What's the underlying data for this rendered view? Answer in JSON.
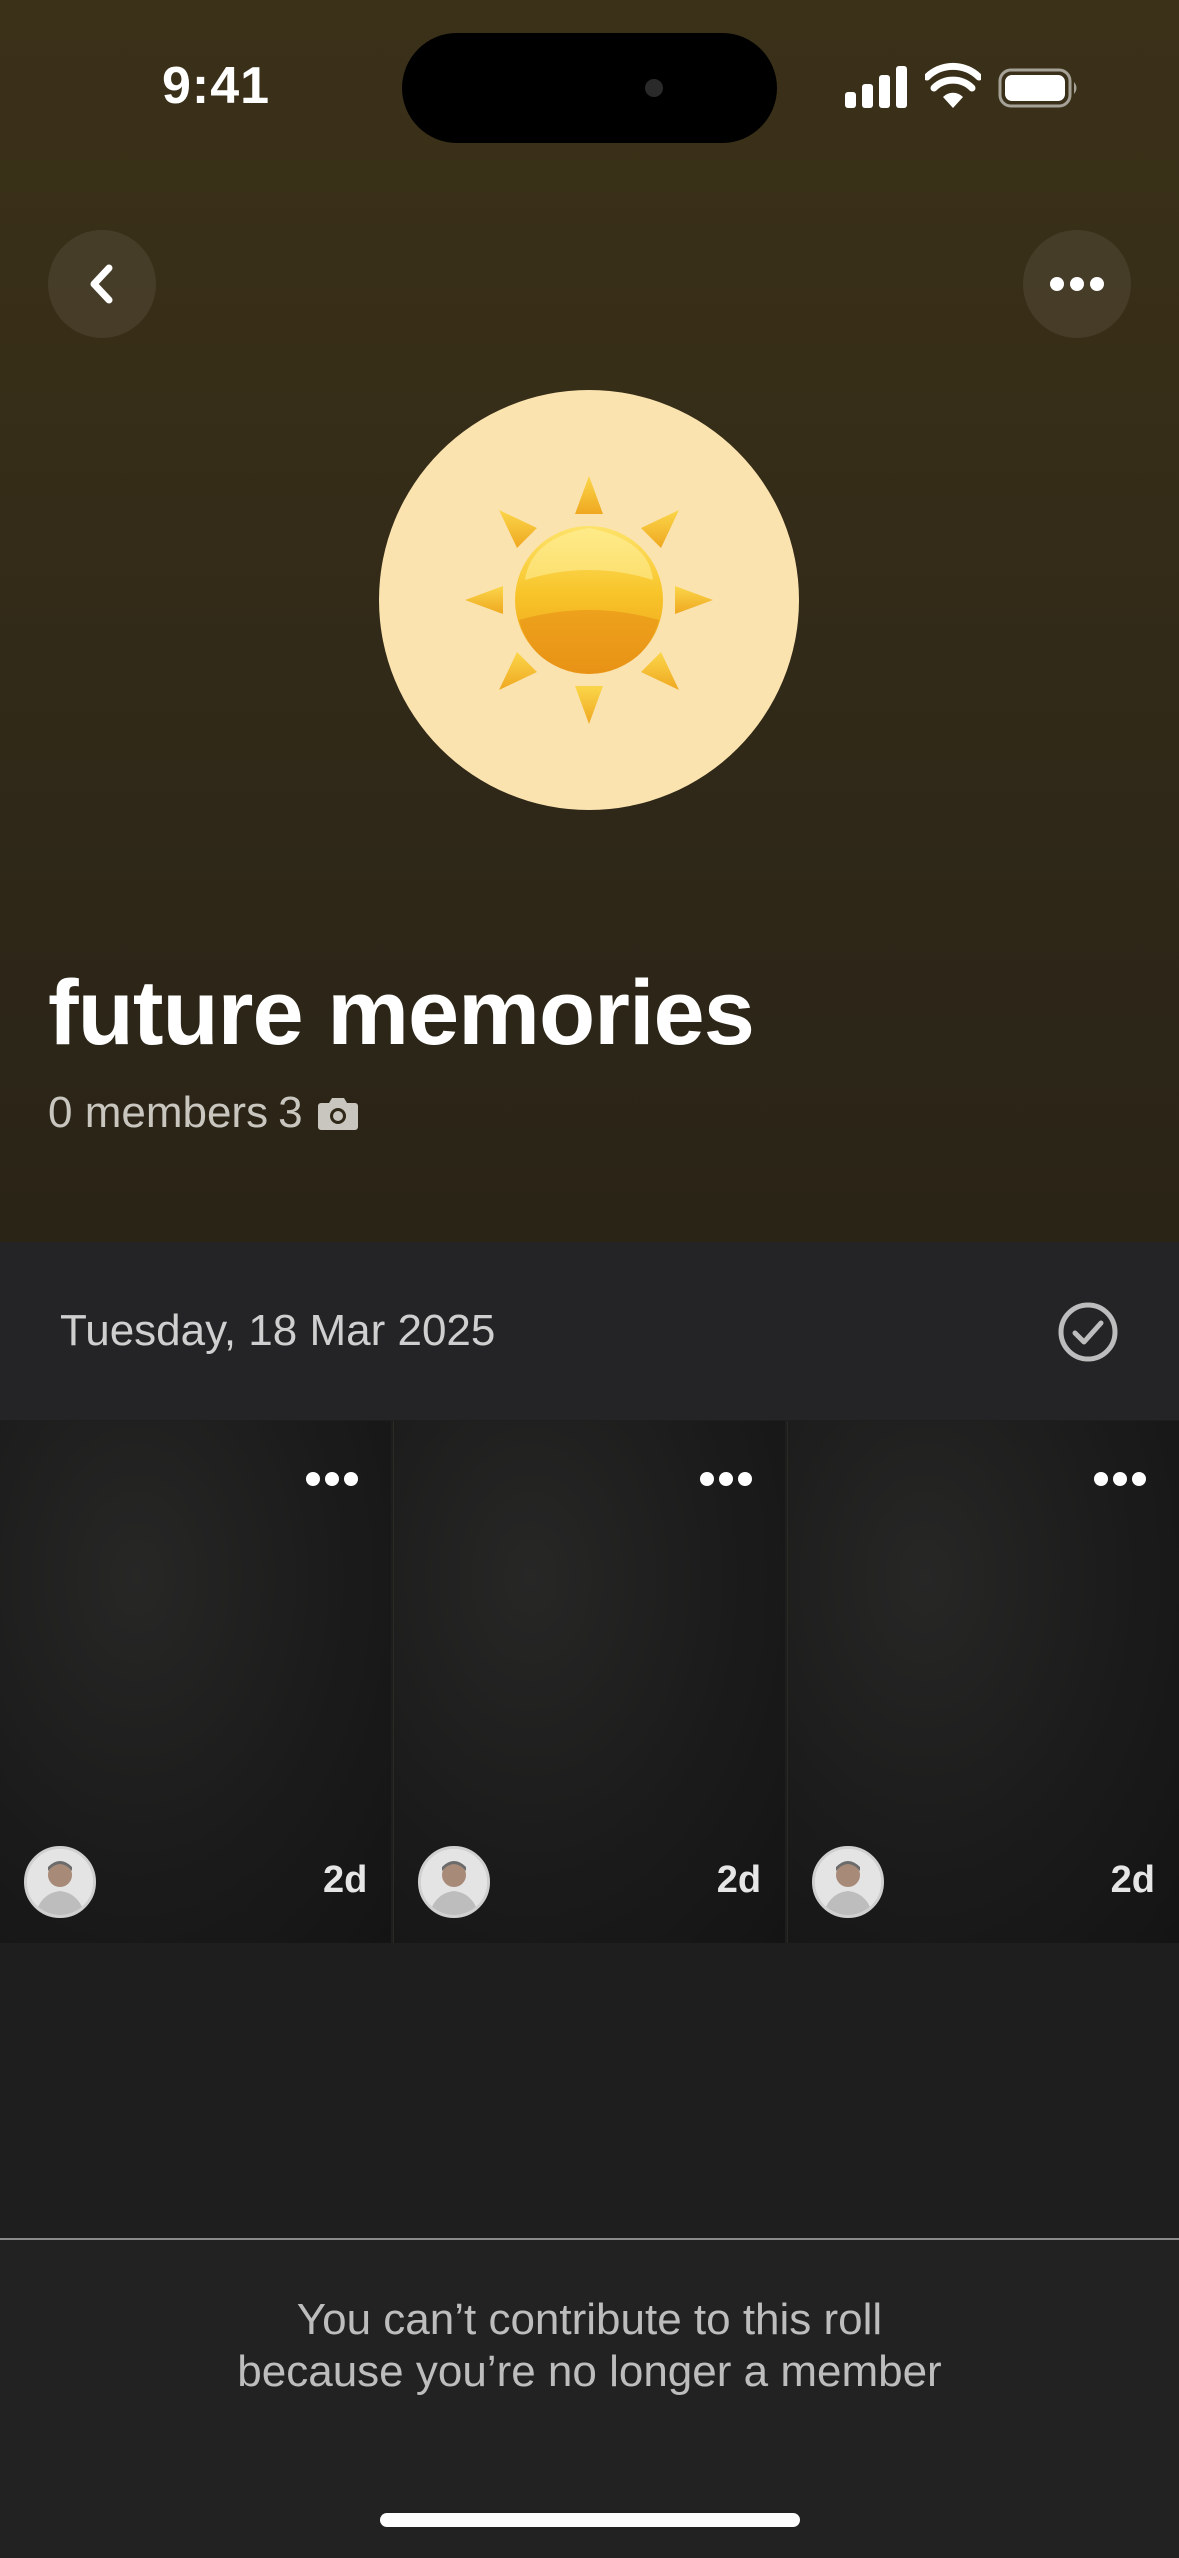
{
  "status_bar": {
    "time": "9:41"
  },
  "header": {
    "back_icon": "chevron-left-icon",
    "more_icon": "ellipsis-icon"
  },
  "roll": {
    "emoji": "sun",
    "title": "future memories",
    "members": "0 members",
    "photo_count": "3",
    "photo_icon": "camera-icon"
  },
  "date_section": {
    "date": "Tuesday, 18 Mar 2025",
    "check_icon": "check-circle-icon"
  },
  "photos": [
    {
      "age": "2d"
    },
    {
      "age": "2d"
    },
    {
      "age": "2d"
    }
  ],
  "footer": {
    "line1": "You can’t contribute to this roll",
    "line2": "because you’re no longer a member"
  },
  "colors": {
    "hero_bg": "#3b3119",
    "body_bg": "#1e1e1f",
    "sun_bg": "#fbe3b0"
  }
}
